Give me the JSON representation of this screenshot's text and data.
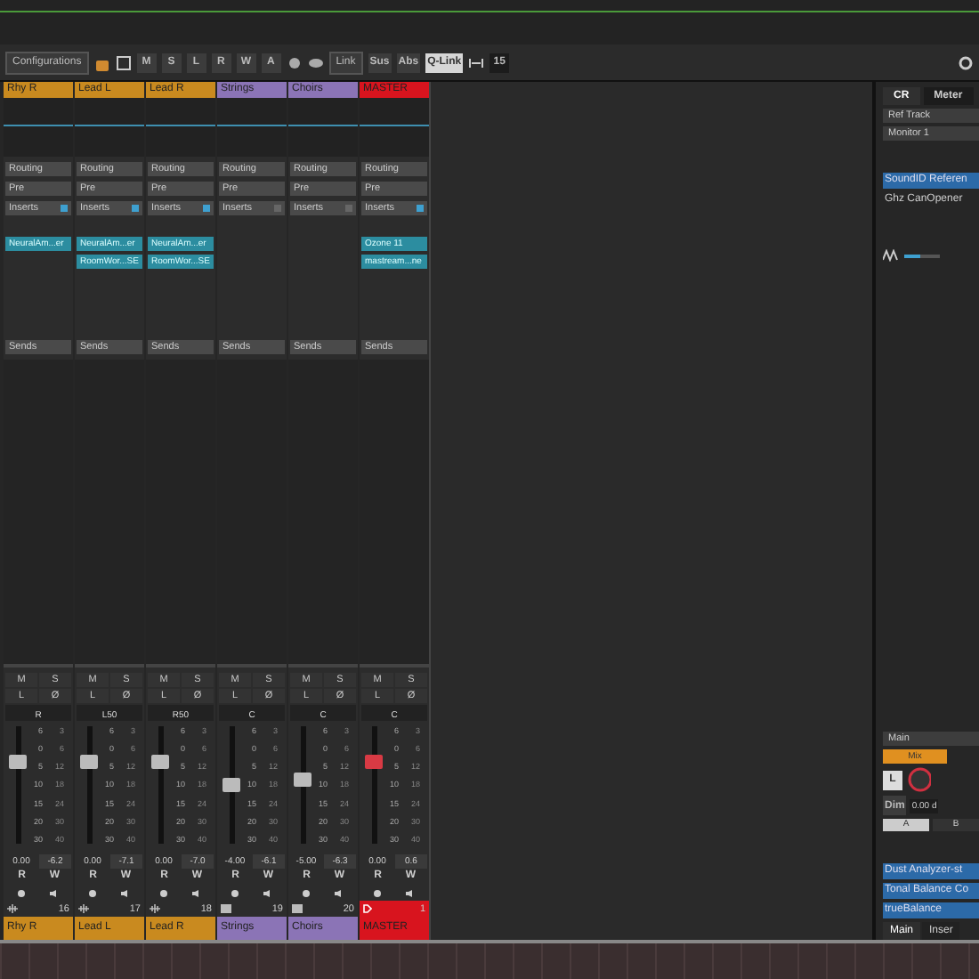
{
  "toolbar": {
    "configurations": "Configurations",
    "state_buttons": [
      "M",
      "S",
      "L",
      "R",
      "W",
      "A"
    ],
    "link": "Link",
    "sus": "Sus",
    "abs": "Abs",
    "qlink": {
      "label": "Q-Link",
      "selected": true
    },
    "width_value": "15"
  },
  "channels": [
    {
      "name": "Rhy R",
      "color": "#c98a1f",
      "routing": "Routing",
      "pre": "Pre",
      "inserts_label": "Inserts",
      "inserts": [
        "NeuralAm...er"
      ],
      "inserts_on": true,
      "sends": "Sends",
      "mute": "M",
      "solo": "S",
      "listen": "L",
      "phase": "Ø",
      "pan": "R",
      "level": 0.72,
      "fader_scale": [
        "6",
        "0",
        "5",
        "10",
        "15",
        "20",
        "30"
      ],
      "meter_scale": [
        "3",
        "6",
        "12",
        "18",
        "24",
        "30",
        "40"
      ],
      "volume": "0.00",
      "peak": "-6.2",
      "read": "R",
      "write": "W",
      "number": "16",
      "footer_name": "Rhy R",
      "kind": "audio"
    },
    {
      "name": "Lead L",
      "color": "#c98a1f",
      "routing": "Routing",
      "pre": "Pre",
      "inserts_label": "Inserts",
      "inserts": [
        "NeuralAm...er",
        "RoomWor...SE"
      ],
      "inserts_on": true,
      "sends": "Sends",
      "mute": "M",
      "solo": "S",
      "listen": "L",
      "phase": "Ø",
      "pan": "L50",
      "level": 0.72,
      "fader_scale": [
        "6",
        "0",
        "5",
        "10",
        "15",
        "20",
        "30"
      ],
      "meter_scale": [
        "3",
        "6",
        "12",
        "18",
        "24",
        "30",
        "40"
      ],
      "volume": "0.00",
      "peak": "-7.1",
      "read": "R",
      "write": "W",
      "number": "17",
      "footer_name": "Lead L",
      "kind": "audio"
    },
    {
      "name": "Lead R",
      "color": "#c98a1f",
      "routing": "Routing",
      "pre": "Pre",
      "inserts_label": "Inserts",
      "inserts": [
        "NeuralAm...er",
        "RoomWor...SE"
      ],
      "inserts_on": true,
      "sends": "Sends",
      "mute": "M",
      "solo": "S",
      "listen": "L",
      "phase": "Ø",
      "pan": "R50",
      "level": 0.72,
      "fader_scale": [
        "6",
        "0",
        "5",
        "10",
        "15",
        "20",
        "30"
      ],
      "meter_scale": [
        "3",
        "6",
        "12",
        "18",
        "24",
        "30",
        "40"
      ],
      "volume": "0.00",
      "peak": "-7.0",
      "read": "R",
      "write": "W",
      "number": "18",
      "footer_name": "Lead R",
      "kind": "audio"
    },
    {
      "name": "Strings",
      "color": "#8b74b6",
      "routing": "Routing",
      "pre": "Pre",
      "inserts_label": "Inserts",
      "inserts_on": false,
      "sends": "Sends",
      "mute": "M",
      "solo": "S",
      "listen": "L",
      "phase": "Ø",
      "pan": "C",
      "level": 0.5,
      "fader_scale": [
        "6",
        "0",
        "5",
        "10",
        "15",
        "20",
        "30"
      ],
      "meter_scale": [
        "3",
        "6",
        "12",
        "18",
        "24",
        "30",
        "40"
      ],
      "volume": "-4.00",
      "peak": "-6.1",
      "read": "R",
      "write": "W",
      "number": "19",
      "footer_name": "Strings",
      "kind": "instrument"
    },
    {
      "name": "Choirs",
      "color": "#8b74b6",
      "routing": "Routing",
      "pre": "Pre",
      "inserts_label": "Inserts",
      "inserts_on": false,
      "sends": "Sends",
      "mute": "M",
      "solo": "S",
      "listen": "L",
      "phase": "Ø",
      "pan": "C",
      "level": 0.55,
      "fader_scale": [
        "6",
        "0",
        "5",
        "10",
        "15",
        "20",
        "30"
      ],
      "meter_scale": [
        "3",
        "6",
        "12",
        "18",
        "24",
        "30",
        "40"
      ],
      "volume": "-5.00",
      "peak": "-6.3",
      "read": "R",
      "write": "W",
      "number": "20",
      "footer_name": "Choirs",
      "kind": "instrument"
    },
    {
      "name": "MASTER",
      "color": "#d8141e",
      "routing": "Routing",
      "pre": "Pre",
      "inserts_label": "Inserts",
      "inserts": [
        "Ozone 11",
        "mastream...ne"
      ],
      "inserts_on": true,
      "sends": "Sends",
      "mute": "M",
      "solo": "S",
      "listen": "L",
      "phase": "Ø",
      "pan": "C",
      "level": 0.72,
      "fader_scale": [
        "6",
        "0",
        "5",
        "10",
        "15",
        "20",
        "30"
      ],
      "meter_scale": [
        "3",
        "6",
        "12",
        "18",
        "24",
        "30",
        "40"
      ],
      "volume": "0.00",
      "peak": "0.6",
      "read": "R",
      "write": "W",
      "number": "1",
      "footer_name": "MASTER",
      "kind": "output"
    }
  ],
  "control_room": {
    "tabs": [
      {
        "label": "CR",
        "selected": true
      },
      {
        "label": "Meter",
        "selected": false
      }
    ],
    "sections": [
      "Ref Track",
      "Monitor 1"
    ],
    "monitor_items": [
      {
        "label": "SoundID Referen",
        "selected": true
      },
      {
        "label": "Ghz CanOpener",
        "selected": false
      }
    ],
    "monitor_slider": {
      "level": 0.45
    },
    "main": "Main",
    "mix": "Mix",
    "ref_letter": "L",
    "dim": "Dim",
    "main_volume": "0.00 d",
    "ab": [
      {
        "label": "A",
        "selected": true
      },
      {
        "label": "B",
        "selected": false
      }
    ],
    "main_items": [
      {
        "label": "Dust Analyzer-st"
      },
      {
        "label": "Tonal Balance Co"
      },
      {
        "label": "trueBalance"
      }
    ],
    "bottom_tabs": [
      {
        "label": "Main",
        "selected": true
      },
      {
        "label": "Inser",
        "selected": false
      }
    ]
  }
}
